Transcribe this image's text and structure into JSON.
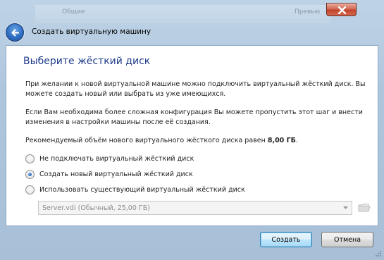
{
  "window": {
    "title": "Создать виртуальную машину",
    "background_hints": [
      "Общие",
      "Превью"
    ]
  },
  "page": {
    "heading": "Выберите жёсткий диск",
    "para1_line1": "При желании к новой виртуальной машине можно подключить виртуальный жёсткий диск. Вы",
    "para1_line2": "можете создать новый или выбрать из уже имеющихся.",
    "para2_line1": "Если Вам необходима более сложная конфигурация Вы можете пропустить этот шаг и внести",
    "para2_line2": "изменения в настройки машины после её создания.",
    "recommended_text": "Рекомендуемый объём нового виртуального жёсткого диска равен",
    "recommended_value": "8,00 ГБ",
    "recommended_suffix": "."
  },
  "options": [
    {
      "label": "Не подключать виртуальный жёсткий диск",
      "checked": false
    },
    {
      "label": "Создать новый виртуальный жёсткий диск",
      "checked": true
    },
    {
      "label": "Использовать существующий виртуальный жёсткий диск",
      "checked": false
    }
  ],
  "existing_disk": {
    "selected": "Server.vdi (Обычный, 25,00 ГБ)",
    "enabled": false
  },
  "buttons": {
    "create": "Создать",
    "cancel": "Отмена"
  },
  "colors": {
    "heading": "#1e3b8c",
    "frame": "#aec6dd",
    "close": "#c1432a",
    "accent": "#2f6fc3"
  },
  "icons": [
    "back-arrow-icon",
    "close-icon",
    "combo-arrow-icon",
    "folder-icon",
    "size-grip-icon"
  ]
}
